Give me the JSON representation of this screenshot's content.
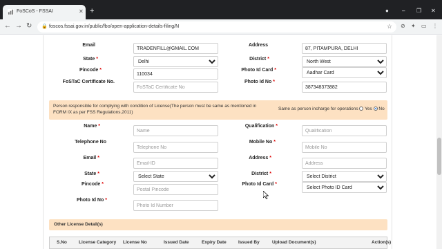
{
  "browser": {
    "tab_title": "FoSCoS - FSSAI",
    "url": "foscos.fssai.gov.in/public/fbo/open-application-details-filing/N"
  },
  "prev_section": {
    "email_label": "Email",
    "email_value": "TRADENFILL@GMAIL.COM",
    "address_label": "Address",
    "address_value": "87, PITAMPURA, DELHI",
    "state_label": "State",
    "state_value": "Delhi",
    "district_label": "District",
    "district_value": "North West",
    "pincode_label": "Pincode",
    "pincode_value": "110034",
    "photo_id_card_label": "Photo Id Card",
    "photo_id_card_value": "Aadhar Card",
    "fostac_label": "FoSTaC Certificate No.",
    "fostac_placeholder": "FoSTaC Certificate No",
    "photo_id_no_label": "Photo Id No",
    "photo_id_no_value": "387348373882"
  },
  "notice": {
    "text": "Person responsible for complying with condition of License(The person must be same as mentioned in FORM IX as per FSS Regulations,2011)",
    "same_as_label": "Same as person incharge for operations",
    "yes_label": "Yes",
    "no_label": "No"
  },
  "responsible_person": {
    "name_label": "Name",
    "name_placeholder": "Name",
    "qualification_label": "Qualification",
    "qualification_placeholder": "Qualification",
    "telephone_label": "Telephone No",
    "telephone_placeholder": "Telephone No",
    "mobile_label": "Mobile No",
    "mobile_placeholder": "Mobile No",
    "email_label": "Email",
    "email_placeholder": "Email-ID",
    "address_label": "Address",
    "address_placeholder": "Address",
    "state_label": "State",
    "state_value": "Select State",
    "district_label": "District",
    "district_value": "Select District",
    "pincode_label": "Pincode",
    "pincode_placeholder": "Postal Pincode",
    "photo_id_card_label": "Photo Id Card",
    "photo_id_card_value": "Select Photo ID Card",
    "photo_id_no_label": "Photo Id No",
    "photo_id_no_placeholder": "Photo Id Number"
  },
  "other_license": {
    "title": "Other License Detail(s)",
    "columns": [
      "S.No",
      "License Category",
      "License No",
      "Issued Date",
      "Expiry Date",
      "Issued By",
      "Upload Document(s)",
      "Action(s)"
    ]
  },
  "colors": {
    "notice_bg": "#fde1c2",
    "required": "#d00000"
  }
}
